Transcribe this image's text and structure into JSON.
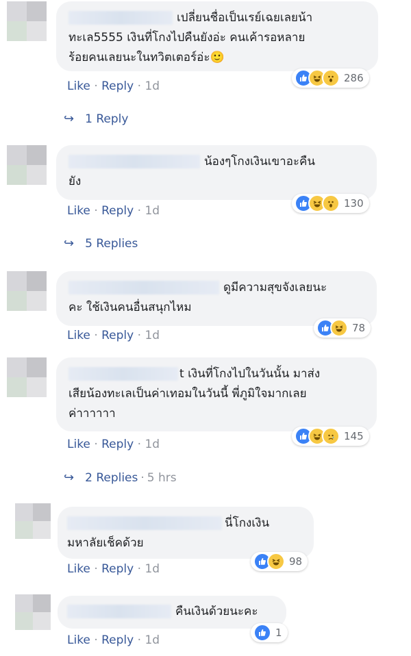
{
  "comments": [
    {
      "text": "เปลี่ยนชื่อเป็นเรย์เฉยเลยน้า\nทะเล5555 เงินที่โกงไปคืนยังอ่ะ คนเค้ารอหลาย\nร้อยคนเลยนะในทวิตเตอร์อ่ะ",
      "emoji": "🙂",
      "reactions": [
        "like",
        "haha",
        "wow"
      ],
      "count": "286",
      "like": "Like",
      "reply": "Reply",
      "time": "1d",
      "replies": "1 Reply"
    },
    {
      "text": "น้องๆโกงเงินเขาอะคืน\nยัง",
      "reactions": [
        "like",
        "haha",
        "wow"
      ],
      "count": "130",
      "like": "Like",
      "reply": "Reply",
      "time": "1d",
      "replies": "5 Replies"
    },
    {
      "text": "ดูมีความสุขจังเลยนะ\nคะ ใช้เงินคนอื่นสนุกไหม",
      "reactions": [
        "like",
        "haha"
      ],
      "count": "78",
      "like": "Like",
      "reply": "Reply",
      "time": "1d"
    },
    {
      "text": "t เงินที่โกงไปในวันนั้น มาส่ง\nเสียน้องทะเลเป็นค่าเทอมในวันนี้ พี่ภูมิใจมากเลย\nค่าาาาาา",
      "reactions": [
        "like",
        "haha",
        "sad"
      ],
      "count": "145",
      "like": "Like",
      "reply": "Reply",
      "time": "1d",
      "replies": "2 Replies",
      "replies_time": "5 hrs"
    },
    {
      "text": "นี่โกงเงิน\nมหาลัยเช็คด้วย",
      "reactions": [
        "like",
        "haha"
      ],
      "count": "98",
      "like": "Like",
      "reply": "Reply",
      "time": "1d"
    },
    {
      "text": "คืนเงินด้วยนะคะ",
      "reactions": [
        "like"
      ],
      "count": "1",
      "like": "Like",
      "reply": "Reply",
      "time": "1d"
    }
  ],
  "colors": {
    "link": "#385898",
    "meta": "#90949c",
    "bubble": "#f2f3f5",
    "like_blue": "#3b82f6",
    "emoji_yellow": "#f7c843"
  }
}
